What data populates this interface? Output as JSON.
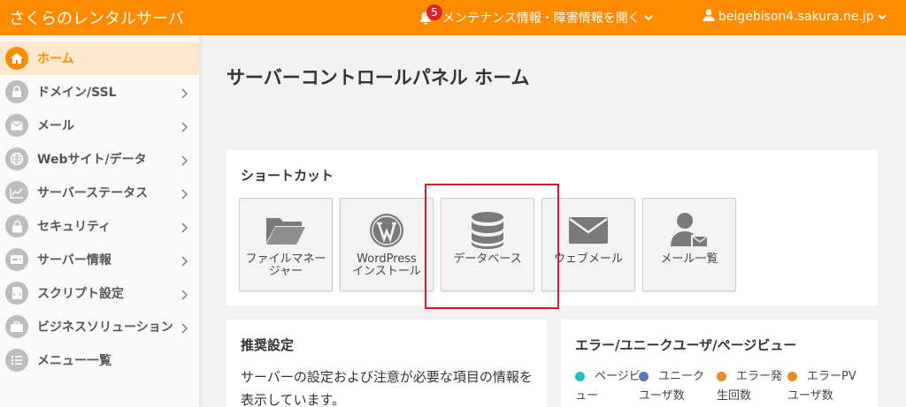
{
  "header": {
    "brand": "さくらのレンタルサーバ",
    "notification_count": "5",
    "maintenance_label": "メンテナンス情報・障害情報を開く",
    "account": "beigebison4.sakura.ne.jp"
  },
  "sidebar": {
    "items": [
      {
        "label": "ホーム",
        "icon": "home-icon"
      },
      {
        "label": "ドメイン/SSL",
        "icon": "domain-icon"
      },
      {
        "label": "メール",
        "icon": "mail-icon"
      },
      {
        "label": "Webサイト/データ",
        "icon": "globe-icon"
      },
      {
        "label": "サーバーステータス",
        "icon": "chart-icon"
      },
      {
        "label": "セキュリティ",
        "icon": "lock-icon"
      },
      {
        "label": "サーバー情報",
        "icon": "server-icon"
      },
      {
        "label": "スクリプト設定",
        "icon": "script-icon"
      },
      {
        "label": "ビジネスソリューション",
        "icon": "briefcase-icon"
      },
      {
        "label": "メニュー一覧",
        "icon": "list-icon"
      }
    ]
  },
  "main": {
    "title": "サーバーコントロールパネル ホーム",
    "shortcuts": {
      "title": "ショートカット",
      "tiles": [
        {
          "label": "ファイルマネー\nジャー",
          "icon": "folder-icon"
        },
        {
          "label": "WordPress\nインストール",
          "icon": "wordpress-icon"
        },
        {
          "label": "データベース",
          "icon": "database-icon"
        },
        {
          "label": "ウェブメール",
          "icon": "envelope-icon"
        },
        {
          "label": "メール一覧",
          "icon": "user-mail-icon"
        }
      ]
    },
    "recommend": {
      "title": "推奨設定",
      "text": "サーバーの設定および注意が必要な項目の情報を表示しています。"
    },
    "stats": {
      "title": "エラー/ユニークユーザ/ページビュー",
      "legend": [
        {
          "label": "ページビュー",
          "color": "#1fc2c2"
        },
        {
          "label": "ユニークユーザ数",
          "color": "#5a77b5"
        },
        {
          "label": "エラー発生回数",
          "color": "#f08a24"
        },
        {
          "label": "エラーPVユーザ数",
          "color": "#f08a24"
        }
      ]
    }
  },
  "colors": {
    "accent": "#ff8c00",
    "highlight": "#d7192c"
  }
}
